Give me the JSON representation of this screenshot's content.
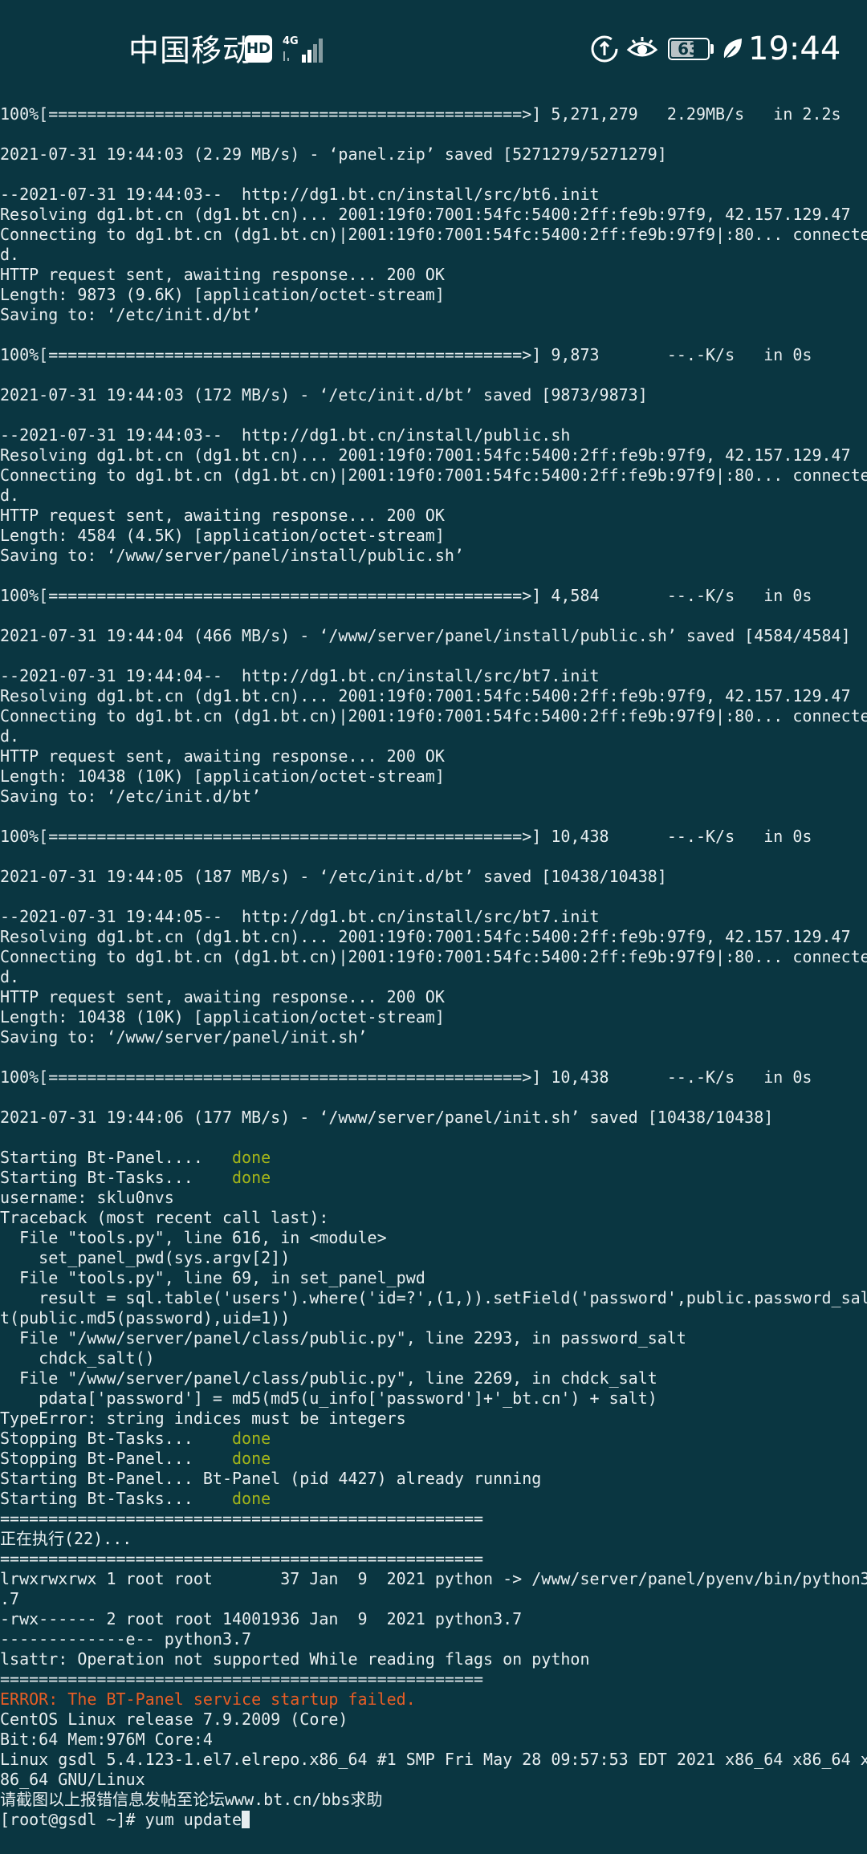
{
  "status_bar": {
    "carrier": "中国移动",
    "hd_badge": "HD",
    "network_type": "4G",
    "battery_level": "63",
    "battery_percent": 63,
    "time": "19:44",
    "icons": [
      "hd-icon",
      "signal-icon",
      "data-saver-icon",
      "eye-comfort-icon",
      "battery-icon",
      "eco-leaf-icon"
    ]
  },
  "terminal": {
    "lines": [
      {
        "text": "100%[=================================================>] 5,271,279   2.29MB/s   in 2.2s"
      },
      {
        "text": ""
      },
      {
        "text": "2021-07-31 19:44:03 (2.29 MB/s) - ‘panel.zip’ saved [5271279/5271279]"
      },
      {
        "text": ""
      },
      {
        "text": "--2021-07-31 19:44:03--  http://dg1.bt.cn/install/src/bt6.init"
      },
      {
        "text": "Resolving dg1.bt.cn (dg1.bt.cn)... 2001:19f0:7001:54fc:5400:2ff:fe9b:97f9, 42.157.129.47"
      },
      {
        "text": "Connecting to dg1.bt.cn (dg1.bt.cn)|2001:19f0:7001:54fc:5400:2ff:fe9b:97f9|:80... connecte"
      },
      {
        "text": "d."
      },
      {
        "text": "HTTP request sent, awaiting response... 200 OK"
      },
      {
        "text": "Length: 9873 (9.6K) [application/octet-stream]"
      },
      {
        "text": "Saving to: ‘/etc/init.d/bt’"
      },
      {
        "text": ""
      },
      {
        "text": "100%[=================================================>] 9,873       --.-K/s   in 0s"
      },
      {
        "text": ""
      },
      {
        "text": "2021-07-31 19:44:03 (172 MB/s) - ‘/etc/init.d/bt’ saved [9873/9873]"
      },
      {
        "text": ""
      },
      {
        "text": "--2021-07-31 19:44:03--  http://dg1.bt.cn/install/public.sh"
      },
      {
        "text": "Resolving dg1.bt.cn (dg1.bt.cn)... 2001:19f0:7001:54fc:5400:2ff:fe9b:97f9, 42.157.129.47"
      },
      {
        "text": "Connecting to dg1.bt.cn (dg1.bt.cn)|2001:19f0:7001:54fc:5400:2ff:fe9b:97f9|:80... connecte"
      },
      {
        "text": "d."
      },
      {
        "text": "HTTP request sent, awaiting response... 200 OK"
      },
      {
        "text": "Length: 4584 (4.5K) [application/octet-stream]"
      },
      {
        "text": "Saving to: ‘/www/server/panel/install/public.sh’"
      },
      {
        "text": ""
      },
      {
        "text": "100%[=================================================>] 4,584       --.-K/s   in 0s"
      },
      {
        "text": ""
      },
      {
        "text": "2021-07-31 19:44:04 (466 MB/s) - ‘/www/server/panel/install/public.sh’ saved [4584/4584]"
      },
      {
        "text": ""
      },
      {
        "text": "--2021-07-31 19:44:04--  http://dg1.bt.cn/install/src/bt7.init"
      },
      {
        "text": "Resolving dg1.bt.cn (dg1.bt.cn)... 2001:19f0:7001:54fc:5400:2ff:fe9b:97f9, 42.157.129.47"
      },
      {
        "text": "Connecting to dg1.bt.cn (dg1.bt.cn)|2001:19f0:7001:54fc:5400:2ff:fe9b:97f9|:80... connecte"
      },
      {
        "text": "d."
      },
      {
        "text": "HTTP request sent, awaiting response... 200 OK"
      },
      {
        "text": "Length: 10438 (10K) [application/octet-stream]"
      },
      {
        "text": "Saving to: ‘/etc/init.d/bt’"
      },
      {
        "text": ""
      },
      {
        "text": "100%[=================================================>] 10,438      --.-K/s   in 0s"
      },
      {
        "text": ""
      },
      {
        "text": "2021-07-31 19:44:05 (187 MB/s) - ‘/etc/init.d/bt’ saved [10438/10438]"
      },
      {
        "text": ""
      },
      {
        "text": "--2021-07-31 19:44:05--  http://dg1.bt.cn/install/src/bt7.init"
      },
      {
        "text": "Resolving dg1.bt.cn (dg1.bt.cn)... 2001:19f0:7001:54fc:5400:2ff:fe9b:97f9, 42.157.129.47"
      },
      {
        "text": "Connecting to dg1.bt.cn (dg1.bt.cn)|2001:19f0:7001:54fc:5400:2ff:fe9b:97f9|:80... connecte"
      },
      {
        "text": "d."
      },
      {
        "text": "HTTP request sent, awaiting response... 200 OK"
      },
      {
        "text": "Length: 10438 (10K) [application/octet-stream]"
      },
      {
        "text": "Saving to: ‘/www/server/panel/init.sh’"
      },
      {
        "text": ""
      },
      {
        "text": "100%[=================================================>] 10,438      --.-K/s   in 0s"
      },
      {
        "text": ""
      },
      {
        "text": "2021-07-31 19:44:06 (177 MB/s) - ‘/www/server/panel/init.sh’ saved [10438/10438]"
      },
      {
        "text": ""
      },
      {
        "text": "Starting Bt-Panel....   ",
        "status": "done"
      },
      {
        "text": "Starting Bt-Tasks...    ",
        "status": "done"
      },
      {
        "text": "username: sklu0nvs"
      },
      {
        "text": "Traceback (most recent call last):"
      },
      {
        "text": "  File \"tools.py\", line 616, in <module>"
      },
      {
        "text": "    set_panel_pwd(sys.argv[2])"
      },
      {
        "text": "  File \"tools.py\", line 69, in set_panel_pwd"
      },
      {
        "text": "    result = sql.table('users').where('id=?',(1,)).setField('password',public.password_sal"
      },
      {
        "text": "t(public.md5(password),uid=1))"
      },
      {
        "text": "  File \"/www/server/panel/class/public.py\", line 2293, in password_salt"
      },
      {
        "text": "    chdck_salt()"
      },
      {
        "text": "  File \"/www/server/panel/class/public.py\", line 2269, in chdck_salt"
      },
      {
        "text": "    pdata['password'] = md5(md5(u_info['password']+'_bt.cn') + salt)"
      },
      {
        "text": "TypeError: string indices must be integers"
      },
      {
        "text": "Stopping Bt-Tasks...    ",
        "status": "done"
      },
      {
        "text": "Stopping Bt-Panel...    ",
        "status": "done"
      },
      {
        "text": "Starting Bt-Panel... Bt-Panel (pid 4427) already running"
      },
      {
        "text": "Starting Bt-Tasks...    ",
        "status": "done"
      },
      {
        "text": "=================================================="
      },
      {
        "text": "正在执行(22)..."
      },
      {
        "text": "=================================================="
      },
      {
        "text": "lrwxrwxrwx 1 root root       37 Jan  9  2021 python -> /www/server/panel/pyenv/bin/python3"
      },
      {
        "text": ".7"
      },
      {
        "text": "-rwx------ 2 root root 14001936 Jan  9  2021 python3.7"
      },
      {
        "text": "-------------e-- python3.7"
      },
      {
        "text": "lsattr: Operation not supported While reading flags on python"
      },
      {
        "text": "=================================================="
      },
      {
        "text": "ERROR: The BT-Panel service startup failed.",
        "style": "error"
      },
      {
        "text": "CentOS Linux release 7.9.2009 (Core)"
      },
      {
        "text": "Bit:64 Mem:976M Core:4"
      },
      {
        "text": "Linux gsdl 5.4.123-1.el7.elrepo.x86_64 #1 SMP Fri May 28 09:57:53 EDT 2021 x86_64 x86_64 x"
      },
      {
        "text": "86_64 GNU/Linux"
      },
      {
        "text": "请截图以上报错信息发帖至论坛www.bt.cn/bbs求助"
      },
      {
        "text": "[root@gsdl ~]# yum update",
        "cursor": true
      }
    ],
    "colors": {
      "background": "#0a3641",
      "text": "#e8eef0",
      "done": "#a3b51a",
      "error": "#e85d25"
    }
  }
}
